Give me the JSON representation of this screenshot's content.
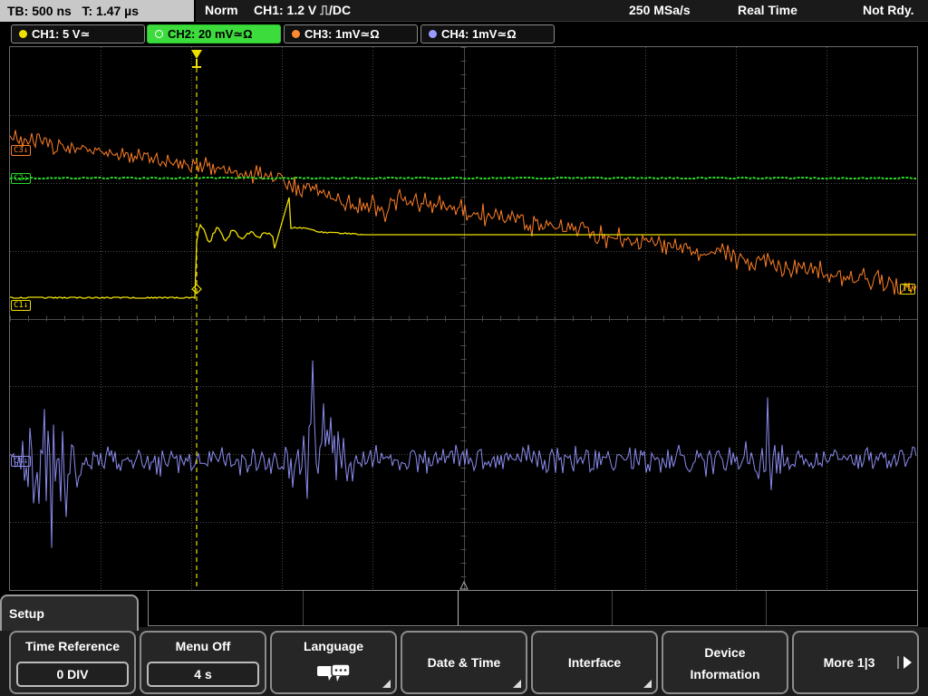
{
  "status": {
    "timebase": "TB: 500 ns",
    "trigger_time": "T: 1.47 µs",
    "trigger_mode": "Norm",
    "trigger_info": "CH1: 1.2 V ⎍/DC",
    "sample_rate": "250 MSa/s",
    "acq_mode": "Real Time",
    "state": "Not Rdy."
  },
  "channels": [
    {
      "label": "CH1: 5 V≃",
      "color": "#f0e000",
      "active": false
    },
    {
      "label": "CH2: 20 mV≃Ω",
      "color": "#3cdc3c",
      "active": true
    },
    {
      "label": "CH3: 1mV≃Ω",
      "color": "#ff8a30",
      "active": false
    },
    {
      "label": "CH4: 1mV≃Ω",
      "color": "#9a9aff",
      "active": false
    }
  ],
  "markers": {
    "ch1": "C1↓",
    "ch2": "C2↓",
    "ch3": "C3↓",
    "ch4": "C4↓",
    "trigger_level": "TL"
  },
  "colors": {
    "ch1": "#f0e000",
    "ch2": "#28d828",
    "ch3": "#ff7f27",
    "ch4": "#8c8cf0",
    "grid": "#4a4a4a",
    "trigger": "#f0e000"
  },
  "menu": {
    "tab_title": "Setup",
    "softkeys": [
      {
        "title": "Time Reference",
        "value": "0 DIV"
      },
      {
        "title": "Menu Off",
        "value": "4 s"
      },
      {
        "title": "Language",
        "icon": "speech-bubbles-icon"
      },
      {
        "title": "Date & Time"
      },
      {
        "title": "Interface"
      },
      {
        "line1": "Device",
        "line2": "Information"
      },
      {
        "title": "More 1|3"
      }
    ]
  }
}
